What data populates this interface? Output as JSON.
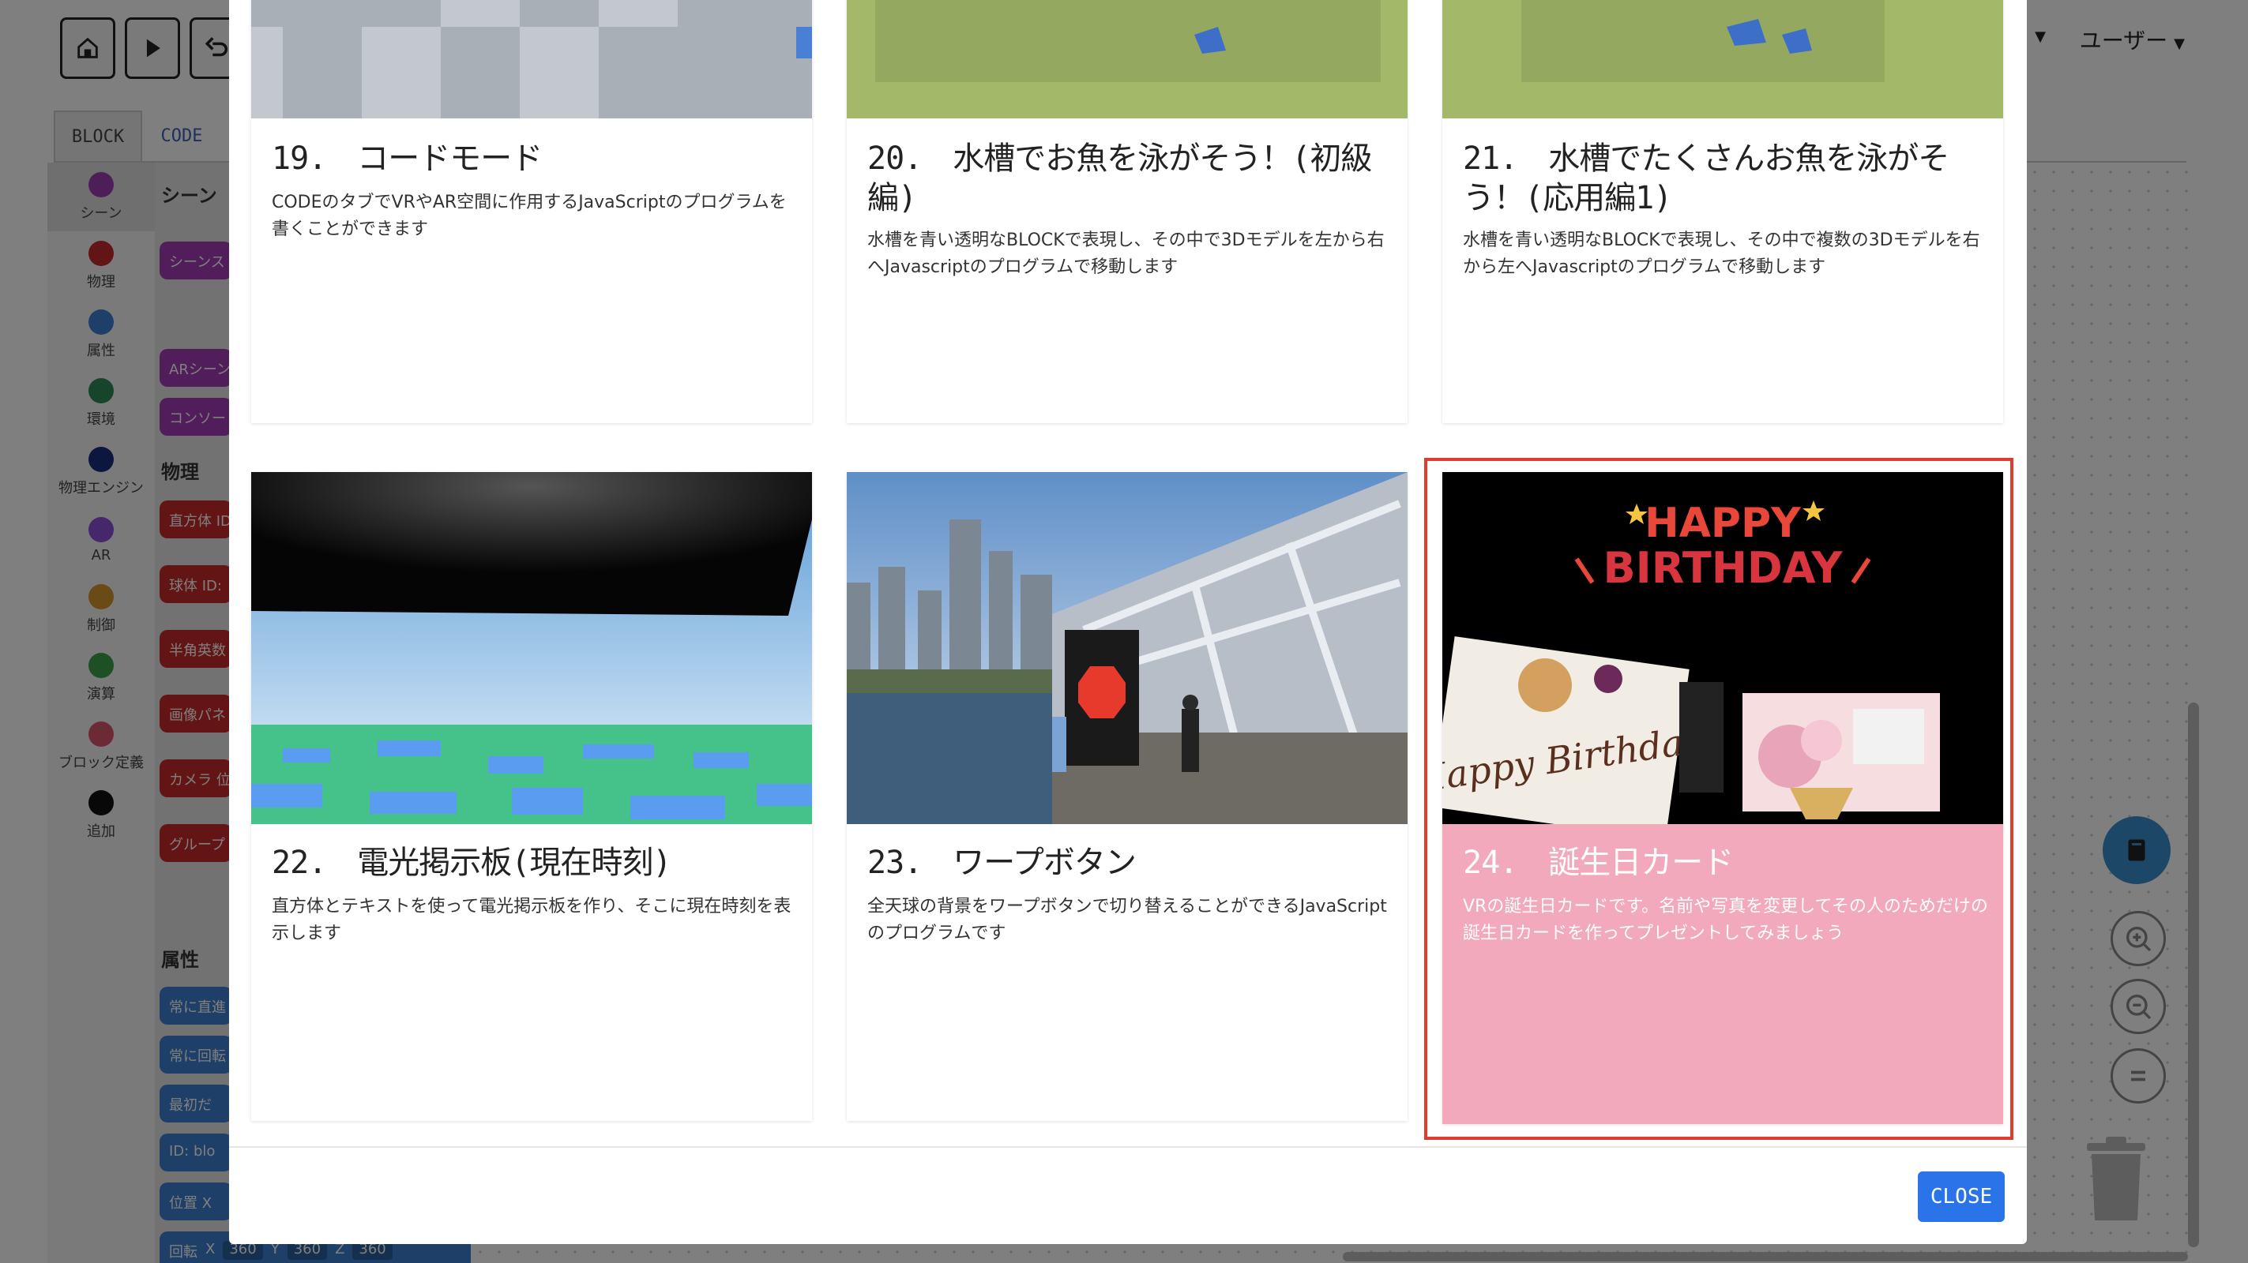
{
  "app": {
    "user_menu": "ユーザー",
    "tabs": {
      "block": "BLOCK",
      "code": "CODE"
    },
    "categories": [
      {
        "label": "シーン",
        "color": "#9b3db0"
      },
      {
        "label": "物理",
        "color": "#c62828"
      },
      {
        "label": "属性",
        "color": "#3a7fd0"
      },
      {
        "label": "環境",
        "color": "#2e8b57"
      },
      {
        "label": "物理エンジン",
        "color": "#1a2f7a"
      },
      {
        "label": "AR",
        "color": "#8d4fd8"
      },
      {
        "label": "制御",
        "color": "#d4962b"
      },
      {
        "label": "演算",
        "color": "#3fa04a"
      },
      {
        "label": "ブロック定義",
        "color": "#d9546a"
      },
      {
        "label": "追加",
        "color": "#111111"
      }
    ],
    "flyout": {
      "heading_scene": "シーン",
      "heading_physics": "物理",
      "heading_attr": "属性",
      "blocks_scene": [
        "シーンス",
        "ARシーン",
        "コンソー"
      ],
      "blocks_physics": [
        "直方体 ID",
        "球体 ID:",
        "半角英数",
        "画像パネ",
        "カメラ 位",
        "グループ"
      ],
      "blocks_attr": [
        "常に直進",
        "常に回転",
        "最初だ",
        "ID: blo",
        "位置 X"
      ],
      "rotate_block": {
        "label": "回転",
        "x_label": "X",
        "x": "360",
        "y_label": "Y",
        "y": "360",
        "z_label": "Z",
        "z": "360"
      }
    }
  },
  "modal": {
    "close_label": "CLOSE",
    "cards": [
      {
        "title": "19.　コードモード",
        "desc": "CODEのタブでVRやAR空間に作用するJavaScriptのプログラムを書くことができます"
      },
      {
        "title": "20.　水槽でお魚を泳がそう！(初級編)",
        "desc": "水槽を青い透明なBLOCKで表現し、その中で3Dモデルを左から右へJavascriptのプログラムで移動します"
      },
      {
        "title": "21.　水槽でたくさんお魚を泳がそう！(応用編1)",
        "desc": "水槽を青い透明なBLOCKで表現し、その中で複数の3Dモデルを右から左へJavascriptのプログラムで移動します"
      },
      {
        "title": "22.　電光掲示板(現在時刻)",
        "desc": "直方体とテキストを使って電光掲示板を作り、そこに現在時刻を表示します"
      },
      {
        "title": "23.　ワープボタン",
        "desc": "全天球の背景をワープボタンで切り替えることができるJavaScriptのプログラムです"
      },
      {
        "title": "24.　誕生日カード",
        "desc": "VRの誕生日カードです。名前や写真を変更してその人のためだけの誕生日カードを作ってプレゼントしてみましょう",
        "selected": true,
        "highlight_color": "#f2a9bb",
        "thumb_text_top": "HAPPY",
        "thumb_text_bottom": "BIRTHDAY",
        "thumb_script": "Happy Birthday"
      }
    ]
  }
}
